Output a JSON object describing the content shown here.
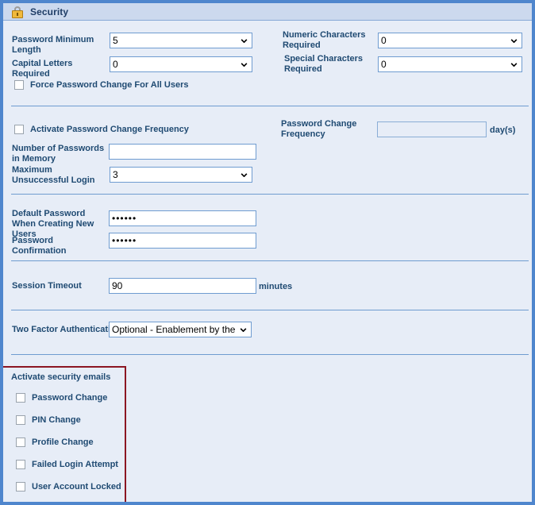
{
  "window": {
    "title": "Security",
    "icon": "padlock-icon"
  },
  "colors": {
    "page_background": "#e7edf7",
    "window_border": "#4f86cd",
    "titlebar_background": "#ccd9ee",
    "label_text": "#1f4a72",
    "divider": "#6f9cd0",
    "annotation_red": "#8c1622",
    "input_border": "#6f9cd0"
  },
  "sections": {
    "password_rules": {
      "fields": [
        {
          "label": "Password Minimum Length",
          "value": "5",
          "control": "select"
        },
        {
          "label": "Capital Letters Required",
          "value": "0",
          "control": "select"
        },
        {
          "label": "Numeric Characters Required",
          "value": "0",
          "control": "select"
        },
        {
          "label": "Special Characters Required",
          "value": "0",
          "control": "select"
        }
      ],
      "force_change": {
        "label": "Force Password Change For All Users",
        "checked": false
      }
    },
    "password_frequency": {
      "activate": {
        "label": "Activate Password Change Frequency",
        "checked": false
      },
      "frequency": {
        "label": "Password Change Frequency",
        "value": "",
        "unit": "day(s)",
        "enabled": false
      },
      "passwords_in_memory": {
        "label": "Number of Passwords in Memory",
        "value": ""
      },
      "max_unsuccessful_login": {
        "label": "Maximum Unsuccessful Login",
        "value": "3",
        "control": "select"
      }
    },
    "default_password": {
      "default_password": {
        "label": "Default Password When Creating New Users",
        "value": "••••••"
      },
      "confirmation": {
        "label": "Password Confirmation",
        "value": "••••••"
      }
    },
    "session": {
      "timeout": {
        "label": "Session Timeout",
        "value": "90",
        "unit": "minutes"
      }
    },
    "two_factor": {
      "label": "Two Factor Authentication",
      "value": "Optional - Enablement by the",
      "control": "select"
    },
    "security_emails": {
      "title": "Activate security emails",
      "items": [
        {
          "label": "Password Change",
          "checked": false
        },
        {
          "label": "PIN Change",
          "checked": false
        },
        {
          "label": "Profile Change",
          "checked": false
        },
        {
          "label": "Failed Login Attempt",
          "checked": false
        },
        {
          "label": "User Account Locked",
          "checked": false
        }
      ]
    }
  }
}
